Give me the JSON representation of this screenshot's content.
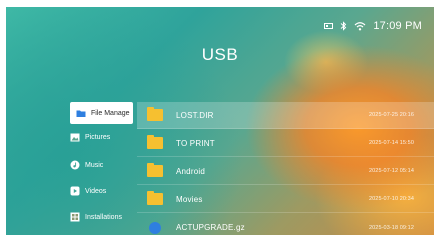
{
  "status": {
    "time": "17:09 PM",
    "icons": [
      "storage-icon",
      "bluetooth-icon",
      "wifi-icon"
    ]
  },
  "title": "USB",
  "sidebar": {
    "items": [
      {
        "label": "File Manage",
        "icon": "folder-icon",
        "active": true
      },
      {
        "label": "Pictures",
        "icon": "picture-icon",
        "active": false
      },
      {
        "label": "Music",
        "icon": "music-icon",
        "active": false
      },
      {
        "label": "Videos",
        "icon": "video-icon",
        "active": false
      },
      {
        "label": "Installations",
        "icon": "apps-icon",
        "active": false
      }
    ]
  },
  "files": [
    {
      "name": "LOST.DIR",
      "date": "2025-07-25 20:16",
      "type": "folder",
      "selected": true
    },
    {
      "name": "TO PRINT",
      "date": "2025-07-14 15:50",
      "type": "folder",
      "selected": false
    },
    {
      "name": "Android",
      "date": "2025-07-12 05:14",
      "type": "folder",
      "selected": false
    },
    {
      "name": "Movies",
      "date": "2025-07-10 20:34",
      "type": "folder",
      "selected": false
    },
    {
      "name": "ACTUPGRADE.gz",
      "date": "2025-03-18 09:12",
      "type": "file",
      "selected": false
    }
  ],
  "colors": {
    "folder": "#f6c030",
    "file": "#2f7fe0",
    "active_bg": "#ffffff"
  }
}
